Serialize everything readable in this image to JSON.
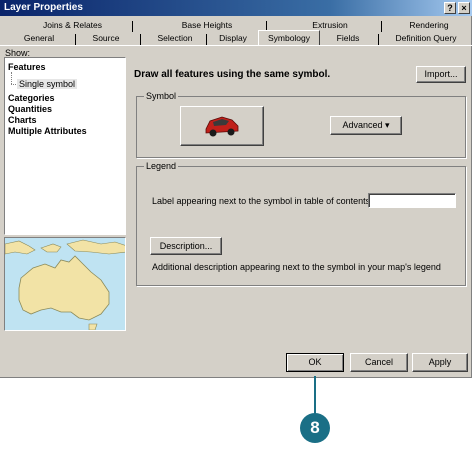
{
  "window": {
    "title": "Layer Properties",
    "help_label": "?"
  },
  "tabs": {
    "row1": [
      "Joins & Relates",
      "Base Heights",
      "Extrusion",
      "Rendering"
    ],
    "row2": [
      "General",
      "Source",
      "Selection",
      "Display",
      "Symbology",
      "Fields",
      "Definition Query"
    ],
    "active": "Symbology"
  },
  "show_label": "Show:",
  "tree": {
    "features": "Features",
    "single_symbol": "Single symbol",
    "categories": "Categories",
    "quantities": "Quantities",
    "charts": "Charts",
    "multiple_attributes": "Multiple Attributes"
  },
  "main": {
    "heading": "Draw all features using the same symbol.",
    "import_label": "Import...",
    "symbol_group_label": "Symbol",
    "advanced_label": "Advanced",
    "legend_group_label": "Legend",
    "label_prompt": "Label appearing next to the symbol in table of contents:",
    "label_value": "",
    "description_button": "Description...",
    "description_help": "Additional description appearing next to the symbol in your map's legend"
  },
  "buttons": {
    "ok": "OK",
    "cancel": "Cancel",
    "apply": "Apply"
  },
  "callout": {
    "number": "8"
  },
  "colors": {
    "title_bar": "#0a246a",
    "dialog_face": "#d4d0c8",
    "callout": "#1a6f86",
    "car": "#c0201a",
    "land": "#f2e3a6",
    "water": "#bfe3f2"
  },
  "icons": {
    "symbol_preview": "red-car-icon",
    "map_preview": "australia-map"
  }
}
